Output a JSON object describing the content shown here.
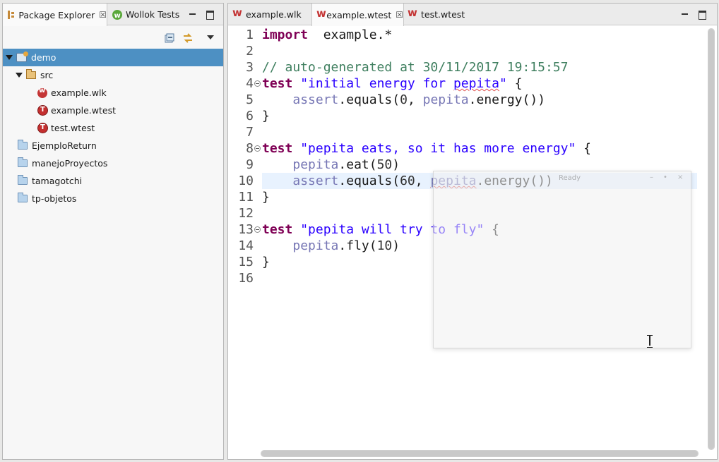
{
  "left_panel": {
    "tabs": [
      {
        "label": "Package Explorer",
        "icon": "package-explorer-icon",
        "active": true,
        "close": "☒"
      },
      {
        "label": "Wollok Tests",
        "icon": "wollok-tests-icon",
        "active": false
      }
    ],
    "toolbar": [
      "collapse-all-icon",
      "link-with-editor-icon",
      "view-menu-icon"
    ],
    "tree": [
      {
        "label": "demo",
        "level": 0,
        "expanded": true,
        "icon": "project-icon",
        "selected": true
      },
      {
        "label": "src",
        "level": 1,
        "expanded": true,
        "icon": "package-folder-icon"
      },
      {
        "label": "example.wlk",
        "level": 2,
        "icon": "wollok-file-icon"
      },
      {
        "label": "example.wtest",
        "level": 2,
        "icon": "wollok-test-file-icon"
      },
      {
        "label": "test.wtest",
        "level": 2,
        "icon": "wollok-test-file-icon"
      },
      {
        "label": "EjemploReturn",
        "level": 0,
        "icon": "folder-icon"
      },
      {
        "label": "manejoProyectos",
        "level": 0,
        "icon": "folder-icon"
      },
      {
        "label": "tamagotchi",
        "level": 0,
        "icon": "folder-icon"
      },
      {
        "label": "tp-objetos",
        "level": 0,
        "icon": "folder-icon"
      }
    ]
  },
  "editor": {
    "tabs": [
      {
        "label": "example.wlk",
        "active": false
      },
      {
        "label": "example.wtest",
        "active": true,
        "close": "☒"
      },
      {
        "label": "test.wtest",
        "active": false
      }
    ],
    "lines": [
      {
        "n": "1",
        "segs": [
          [
            "kw",
            "import"
          ],
          [
            "",
            "  example.*"
          ]
        ]
      },
      {
        "n": "2",
        "segs": []
      },
      {
        "n": "3",
        "segs": [
          [
            "cmt",
            "// auto-generated at 30/11/2017 19:15:57"
          ]
        ]
      },
      {
        "n": "4",
        "fold": true,
        "segs": [
          [
            "kw",
            "test"
          ],
          [
            "",
            " "
          ],
          [
            "str",
            "\"initial energy for "
          ],
          [
            "str squig",
            "pepita"
          ],
          [
            "str",
            "\""
          ],
          [
            "",
            " {"
          ]
        ]
      },
      {
        "n": "5",
        "segs": [
          [
            "",
            "    "
          ],
          [
            "var",
            "assert"
          ],
          [
            "",
            ".equals("
          ],
          [
            "num",
            "0"
          ],
          [
            "",
            ", "
          ],
          [
            "var",
            "pepita"
          ],
          [
            "",
            ".energy())"
          ]
        ]
      },
      {
        "n": "6",
        "segs": [
          [
            "",
            "}"
          ]
        ]
      },
      {
        "n": "7",
        "segs": []
      },
      {
        "n": "8",
        "fold": true,
        "segs": [
          [
            "kw",
            "test"
          ],
          [
            "",
            " "
          ],
          [
            "str",
            "\"pepita eats, so it has more energy\""
          ],
          [
            "",
            " {"
          ]
        ]
      },
      {
        "n": "9",
        "segs": [
          [
            "",
            "    "
          ],
          [
            "var",
            "pepita"
          ],
          [
            "",
            ".eat("
          ],
          [
            "num",
            "50"
          ],
          [
            "",
            ")"
          ]
        ]
      },
      {
        "n": "10",
        "highlight": true,
        "segs": [
          [
            "",
            "    "
          ],
          [
            "var",
            "assert"
          ],
          [
            "",
            ".equals("
          ],
          [
            "num",
            "60"
          ],
          [
            "",
            ", "
          ],
          [
            "var squig",
            "pepita"
          ],
          [
            "",
            ".energy())"
          ]
        ]
      },
      {
        "n": "11",
        "segs": [
          [
            "",
            "}"
          ]
        ]
      },
      {
        "n": "12",
        "segs": []
      },
      {
        "n": "13",
        "fold": true,
        "segs": [
          [
            "kw",
            "test"
          ],
          [
            "",
            " "
          ],
          [
            "str",
            "\"pepita will try to fly\""
          ],
          [
            "",
            " {"
          ]
        ]
      },
      {
        "n": "14",
        "segs": [
          [
            "",
            "    "
          ],
          [
            "var",
            "pepita"
          ],
          [
            "",
            ".fly("
          ],
          [
            "num",
            "10"
          ],
          [
            "",
            ")"
          ]
        ]
      },
      {
        "n": "15",
        "segs": [
          [
            "",
            "}"
          ]
        ]
      },
      {
        "n": "16",
        "segs": []
      }
    ]
  },
  "ghost_popup": {
    "title": "Ready"
  }
}
